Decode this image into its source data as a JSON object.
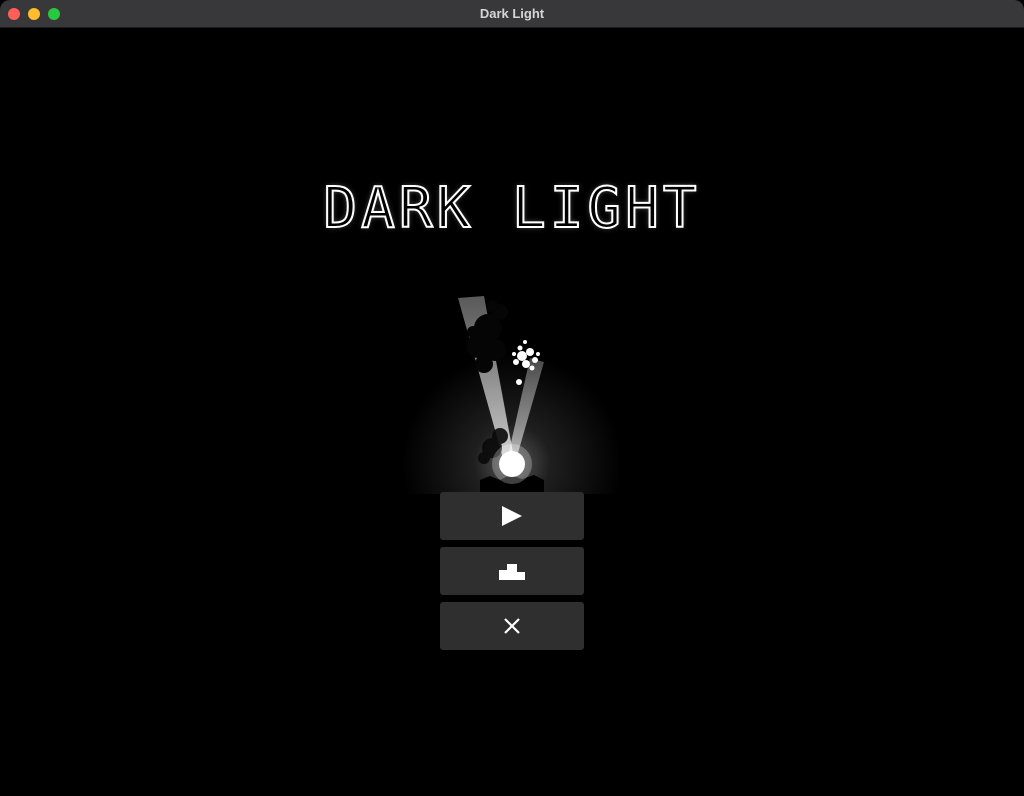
{
  "window": {
    "title": "Dark Light"
  },
  "game": {
    "title": "DARK LIGHT",
    "menu": [
      {
        "id": "play",
        "icon": "play-icon"
      },
      {
        "id": "leaderboard",
        "icon": "podium-icon"
      },
      {
        "id": "quit",
        "icon": "close-icon"
      }
    ]
  },
  "colors": {
    "background": "#000000",
    "titlebar": "#38383a",
    "button": "#2f2f2f",
    "foreground": "#ffffff"
  }
}
